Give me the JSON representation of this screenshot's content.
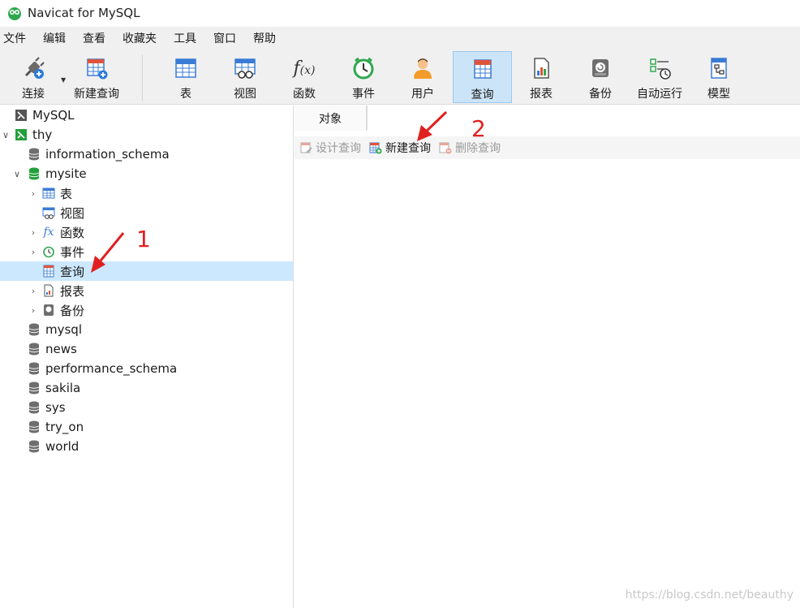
{
  "window": {
    "title": "Navicat for MySQL"
  },
  "menu": [
    "文件",
    "编辑",
    "查看",
    "收藏夹",
    "工具",
    "窗口",
    "帮助"
  ],
  "toolbar": {
    "connect": "连接",
    "new_query": "新建查询",
    "table": "表",
    "view": "视图",
    "function": "函数",
    "event": "事件",
    "user": "用户",
    "query": "查询",
    "report": "报表",
    "backup": "备份",
    "autorun": "自动运行",
    "model": "模型"
  },
  "tree": {
    "root": "MySQL",
    "connection": "thy",
    "items": [
      "information_schema",
      "mysite",
      "表",
      "视图",
      "函数",
      "事件",
      "查询",
      "报表",
      "备份",
      "mysql",
      "news",
      "performance_schema",
      "sakila",
      "sys",
      "try_on",
      "world"
    ]
  },
  "objects": {
    "tab": "对象",
    "design_query": "设计查询",
    "new_query": "新建查询",
    "delete_query": "删除查询"
  },
  "annotations": {
    "one": "1",
    "two": "2"
  },
  "watermark": "https://blog.csdn.net/beauthy",
  "colors": {
    "accent": "#cce4f7",
    "selection": "#cce8ff",
    "arrow": "#e02020",
    "db_green": "#23a03c"
  }
}
